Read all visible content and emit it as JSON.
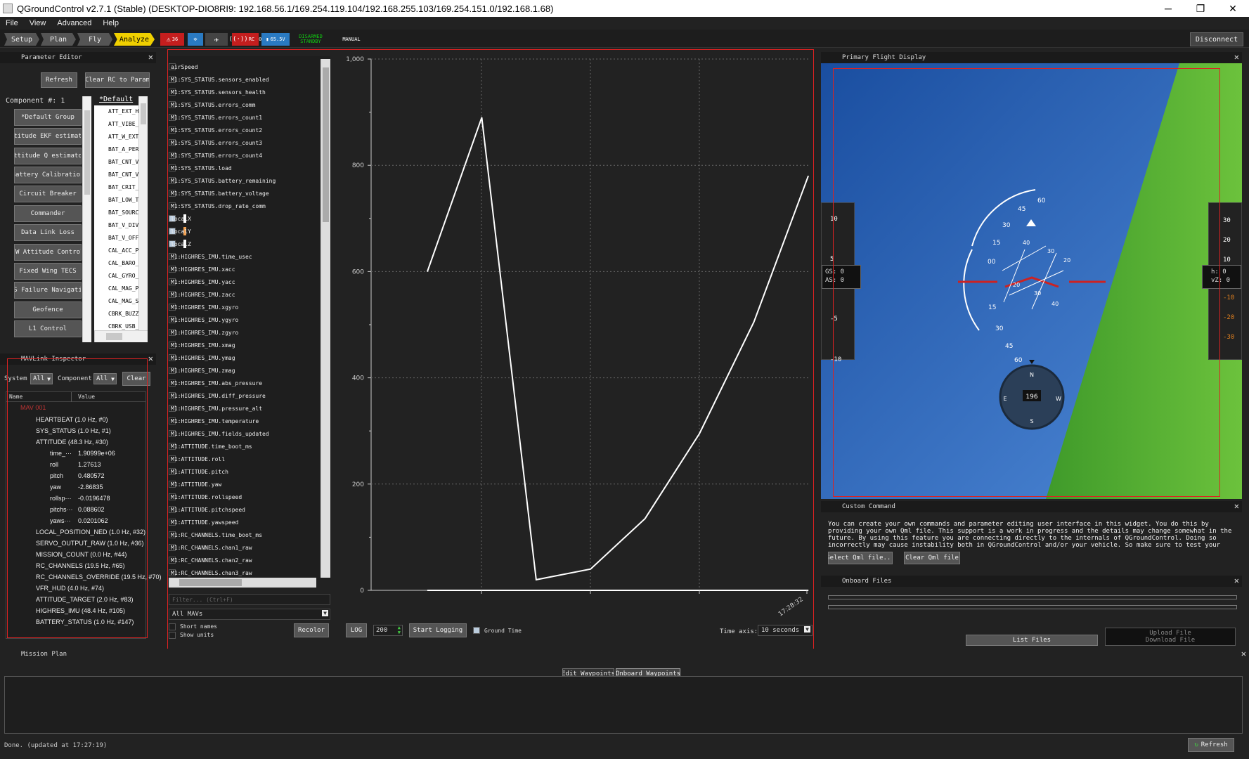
{
  "window": {
    "title": "QGroundControl v2.7.1 (Stable) (DESKTOP-DIO8RI9: 192.168.56.1/169.254.119.104/192.168.255.103/169.254.151.0/192.168.1.68)",
    "minimize": "─",
    "restore": "❐",
    "close": "✕"
  },
  "menu": [
    "File",
    "View",
    "Advanced",
    "Help"
  ],
  "toolbar": {
    "modes": [
      {
        "label": "Setup"
      },
      {
        "label": "Plan"
      },
      {
        "label": "Fly"
      },
      {
        "label": "Analyze"
      }
    ],
    "active_mode": "Analyze",
    "status": {
      "warning_count": "36",
      "radio_label": "RC",
      "radio_value": "0",
      "battery": "65.5V",
      "armed_state": "DISARMED",
      "flight_state": "STANDBY",
      "mode": "MANUAL"
    },
    "disconnect_label": "Disconnect"
  },
  "parameter_editor": {
    "title": "Parameter Editor",
    "refresh_label": "Refresh",
    "clear_rc_label": "Clear RC to Param",
    "component_label": "Component #: 1",
    "list_header": "*Default",
    "groups": [
      "*Default Group",
      "Attitude EKF estimator",
      "Attitude Q estimator",
      "Battery Calibration",
      "Circuit Breaker",
      "Commander",
      "Data Link Loss",
      "FW Attitude Control",
      "Fixed Wing TECS",
      "GPS Failure Navigation",
      "Geofence",
      "L1 Control"
    ],
    "params": [
      "ATT_EXT_H",
      "ATT_VIBE_",
      "ATT_W_EXT",
      "BAT_A_PER",
      "BAT_CNT_V",
      "BAT_CNT_V",
      "BAT_CRIT_",
      "BAT_LOW_T",
      "BAT_SOURC",
      "BAT_V_DIV",
      "BAT_V_OFF",
      "CAL_ACC_P",
      "CAL_BARO_",
      "CAL_GYRO_",
      "CAL_MAG_P",
      "CAL_MAG_S",
      "CBRK_BUZZ",
      "CBRK_USB_"
    ]
  },
  "mavlink_inspector": {
    "title": "MAVLink Inspector",
    "system_label": "System",
    "system_value": "All",
    "component_label": "Component",
    "component_value": "All",
    "clear_label": "Clear",
    "col_name": "Name",
    "col_value": "Value",
    "root": "MAV 001",
    "messages": [
      "HEARTBEAT (1.0 Hz, #0)",
      "SYS_STATUS (1.0 Hz, #1)",
      "ATTITUDE (48.3 Hz, #30)"
    ],
    "attitude_fields": [
      {
        "name": "time_···",
        "value": "1.90999e+06"
      },
      {
        "name": "roll",
        "value": "1.27613"
      },
      {
        "name": "pitch",
        "value": "0.480572"
      },
      {
        "name": "yaw",
        "value": "-2.86835"
      },
      {
        "name": "rollsp···",
        "value": "-0.0196478"
      },
      {
        "name": "pitchs···",
        "value": "0.088602"
      },
      {
        "name": "yaws···",
        "value": "0.0201062"
      }
    ],
    "more_messages": [
      "LOCAL_POSITION_NED (1.0 Hz, #32)",
      "SERVO_OUTPUT_RAW (1.0 Hz, #36)",
      "MISSION_COUNT (0.0 Hz, #44)",
      "RC_CHANNELS (19.5 Hz, #65)",
      "RC_CHANNELS_OVERRIDE (19.5 Hz, #70)",
      "VFR_HUD (4.0 Hz, #74)",
      "ATTITUDE_TARGET (2.0 Hz, #83)",
      "HIGHRES_IMU (48.4 Hz, #105)",
      "BATTERY_STATUS (1.0 Hz, #147)"
    ]
  },
  "plot": {
    "items": [
      {
        "label": "airSpeed",
        "checked": false,
        "color": ""
      },
      {
        "label": "M1:SYS_STATUS.sensors_enabled",
        "checked": false,
        "color": ""
      },
      {
        "label": "M1:SYS_STATUS.sensors_health",
        "checked": false,
        "color": ""
      },
      {
        "label": "M1:SYS_STATUS.errors_comm",
        "checked": false,
        "color": ""
      },
      {
        "label": "M1:SYS_STATUS.errors_count1",
        "checked": false,
        "color": ""
      },
      {
        "label": "M1:SYS_STATUS.errors_count2",
        "checked": false,
        "color": ""
      },
      {
        "label": "M1:SYS_STATUS.errors_count3",
        "checked": false,
        "color": ""
      },
      {
        "label": "M1:SYS_STATUS.errors_count4",
        "checked": false,
        "color": ""
      },
      {
        "label": "M1:SYS_STATUS.load",
        "checked": false,
        "color": ""
      },
      {
        "label": "M1:SYS_STATUS.battery_remaining",
        "checked": false,
        "color": ""
      },
      {
        "label": "M1:SYS_STATUS.battery_voltage",
        "checked": false,
        "color": ""
      },
      {
        "label": "M1:SYS_STATUS.drop_rate_comm",
        "checked": false,
        "color": ""
      },
      {
        "label": "localX",
        "checked": true,
        "color": "#ffffff"
      },
      {
        "label": "localY",
        "checked": true,
        "color": "#f0a050"
      },
      {
        "label": "localZ",
        "checked": true,
        "color": "#ffffff"
      },
      {
        "label": "M1:HIGHRES_IMU.time_usec",
        "checked": false,
        "color": ""
      },
      {
        "label": "M1:HIGHRES_IMU.xacc",
        "checked": false,
        "color": ""
      },
      {
        "label": "M1:HIGHRES_IMU.yacc",
        "checked": false,
        "color": ""
      },
      {
        "label": "M1:HIGHRES_IMU.zacc",
        "checked": false,
        "color": ""
      },
      {
        "label": "M1:HIGHRES_IMU.xgyro",
        "checked": false,
        "color": ""
      },
      {
        "label": "M1:HIGHRES_IMU.ygyro",
        "checked": false,
        "color": ""
      },
      {
        "label": "M1:HIGHRES_IMU.zgyro",
        "checked": false,
        "color": ""
      },
      {
        "label": "M1:HIGHRES_IMU.xmag",
        "checked": false,
        "color": ""
      },
      {
        "label": "M1:HIGHRES_IMU.ymag",
        "checked": false,
        "color": ""
      },
      {
        "label": "M1:HIGHRES_IMU.zmag",
        "checked": false,
        "color": ""
      },
      {
        "label": "M1:HIGHRES_IMU.abs_pressure",
        "checked": false,
        "color": ""
      },
      {
        "label": "M1:HIGHRES_IMU.diff_pressure",
        "checked": false,
        "color": ""
      },
      {
        "label": "M1:HIGHRES_IMU.pressure_alt",
        "checked": false,
        "color": ""
      },
      {
        "label": "M1:HIGHRES_IMU.temperature",
        "checked": false,
        "color": ""
      },
      {
        "label": "M1:HIGHRES_IMU.fields_updated",
        "checked": false,
        "color": ""
      },
      {
        "label": "M1:ATTITUDE.time_boot_ms",
        "checked": false,
        "color": ""
      },
      {
        "label": "M1:ATTITUDE.roll",
        "checked": false,
        "color": ""
      },
      {
        "label": "M1:ATTITUDE.pitch",
        "checked": false,
        "color": ""
      },
      {
        "label": "M1:ATTITUDE.yaw",
        "checked": false,
        "color": ""
      },
      {
        "label": "M1:ATTITUDE.rollspeed",
        "checked": false,
        "color": ""
      },
      {
        "label": "M1:ATTITUDE.pitchspeed",
        "checked": false,
        "color": ""
      },
      {
        "label": "M1:ATTITUDE.yawspeed",
        "checked": false,
        "color": ""
      },
      {
        "label": "M1:RC_CHANNELS.time_boot_ms",
        "checked": false,
        "color": ""
      },
      {
        "label": "M1:RC_CHANNELS.chan1_raw",
        "checked": false,
        "color": ""
      },
      {
        "label": "M1:RC_CHANNELS.chan2_raw",
        "checked": false,
        "color": ""
      },
      {
        "label": "M1:RC_CHANNELS.chan3_raw",
        "checked": false,
        "color": ""
      }
    ],
    "filter_placeholder": "Filter... (Ctrl+F)",
    "mav_select": "All MAVs",
    "short_names_label": "Short names",
    "show_units_label": "Show units",
    "recolor_label": "Recolor",
    "log_label": "LOG",
    "rate_value": "200",
    "start_logging_label": "Start Logging",
    "ground_time_label": "Ground Time",
    "time_axis_label": "Time axis:",
    "time_axis_value": "10 seconds"
  },
  "chart_data": {
    "type": "line",
    "title": "",
    "xlabel": "",
    "ylabel": "",
    "ylim": [
      0,
      1000
    ],
    "yticks": [
      "1,000",
      "800",
      "600",
      "400",
      "200",
      "0"
    ],
    "xtick_labels": [
      "17:28:32"
    ],
    "grid": true,
    "series": [
      {
        "color": "#ffffff",
        "values": [
          600,
          890,
          20,
          40,
          135,
          295,
          505,
          780
        ]
      },
      {
        "color": "#ffffff",
        "values": [
          0,
          0,
          0,
          0,
          0,
          0,
          0,
          0
        ]
      }
    ]
  },
  "pfd": {
    "title": "Primary Flight Display",
    "gs_label": "GS: 0",
    "as_label": "AS: 0",
    "h_label": "h: 0",
    "vz_label": "vZ: 0",
    "heading": "196",
    "left_tape": [
      "10",
      "5",
      "-5",
      "-10"
    ],
    "right_tape": [
      "30",
      "20",
      "10",
      "-10",
      "-20",
      "-30"
    ],
    "roll_marks": [
      "60",
      "45",
      "30",
      "15",
      "00",
      "15",
      "30",
      "45",
      "60"
    ],
    "pitch_marks": [
      "40",
      "30",
      "20",
      "20",
      "30",
      "40"
    ],
    "compass": [
      "N",
      "E",
      "S",
      "W"
    ]
  },
  "custom_command": {
    "title": "Custom Command",
    "text": "You can create your own commands and parameter editing user interface in this widget. You do this by providing your own Qml file. This support is a work in progress and the details may change somewhat in the future. By using this feature you are connecting directly to the internals of QGroundControl. Doing so incorrectly may cause instability both in QGroundControl and/or your vehicle. So make sure to test your changes thoroughly before using them in",
    "select_label": "Select Qml file...",
    "clear_label": "Clear Qml file"
  },
  "onboard_files": {
    "title": "Onboard Files",
    "list_label": "List Files",
    "upload_label": "Upload File",
    "download_label": "Download File"
  },
  "mission_plan": {
    "title": "Mission Plan",
    "edit_label": "Edit Waypoints",
    "onboard_label": "Onboard Waypoints",
    "status": "Done. (updated at 17:27:19)",
    "refresh_label": "Refresh"
  }
}
